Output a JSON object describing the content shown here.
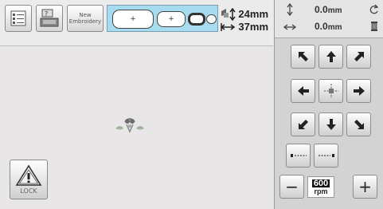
{
  "toolbar": {
    "new_embroidery_line1": "New",
    "new_embroidery_line2": "Embroidery"
  },
  "frames": {
    "labels": [
      "+",
      "+"
    ]
  },
  "pattern_size": {
    "height": "24mm",
    "width": "37mm"
  },
  "position": {
    "y": "0.0",
    "y_unit": "mm",
    "x": "0.0",
    "x_unit": "mm"
  },
  "lock": {
    "label": "LOCK"
  },
  "speed": {
    "value": "600",
    "unit": "rpm",
    "minus_label": "−",
    "plus_label": "+"
  },
  "colors": {
    "frame_highlight": "#a7dbf0",
    "panel_bg": "#d3d3d3",
    "canvas_bg": "#e8e6e6"
  }
}
